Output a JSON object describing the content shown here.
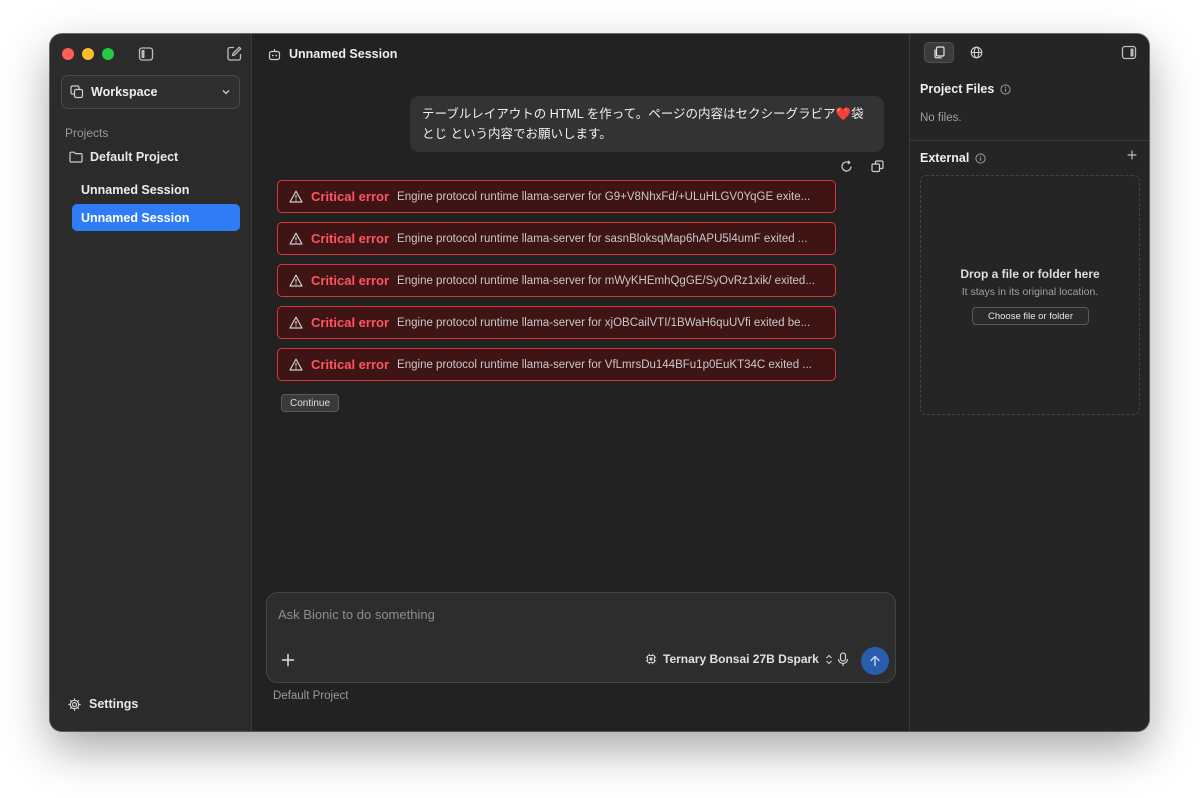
{
  "sidebar": {
    "workspace_label": "Workspace",
    "section_label": "Projects",
    "project_name": "Default Project",
    "sessions": [
      {
        "label": "Unnamed Session"
      },
      {
        "label": "Unnamed Session"
      }
    ],
    "settings_label": "Settings"
  },
  "main": {
    "title": "Unnamed Session",
    "user_message": "テーブルレイアウトの HTML を作って。ページの内容はセクシーグラビア❤️袋とじ という内容でお願いします。",
    "errors": [
      {
        "title": "Critical error",
        "detail": "Engine protocol runtime llama-server for G9+V8NhxFd/+ULuHLGV0YqGE exite..."
      },
      {
        "title": "Critical error",
        "detail": "Engine protocol runtime llama-server for sasnBloksqMap6hAPU5l4umF exited ..."
      },
      {
        "title": "Critical error",
        "detail": "Engine protocol runtime llama-server for mWyKHEmhQgGE/SyOvRz1xik/ exited..."
      },
      {
        "title": "Critical error",
        "detail": "Engine protocol runtime llama-server for xjOBCailVTI/1BWaH6quUVfi exited be..."
      },
      {
        "title": "Critical error",
        "detail": "Engine protocol runtime llama-server for VfLmrsDu144BFu1p0EuKT34C exited ..."
      }
    ],
    "continue_label": "Continue",
    "composer": {
      "placeholder": "Ask Bionic to do something",
      "model_label": "Ternary Bonsai 27B Dspark"
    },
    "footer_project": "Default Project"
  },
  "right_panel": {
    "files_title": "Project Files",
    "files_empty": "No files.",
    "external_title": "External",
    "drop_title": "Drop a file or folder here",
    "drop_subtitle": "It stays in its original location.",
    "choose_label": "Choose file or folder"
  },
  "colors": {
    "accent": "#2f7cf6",
    "error": "#ff5560",
    "send": "#2b5dad"
  }
}
